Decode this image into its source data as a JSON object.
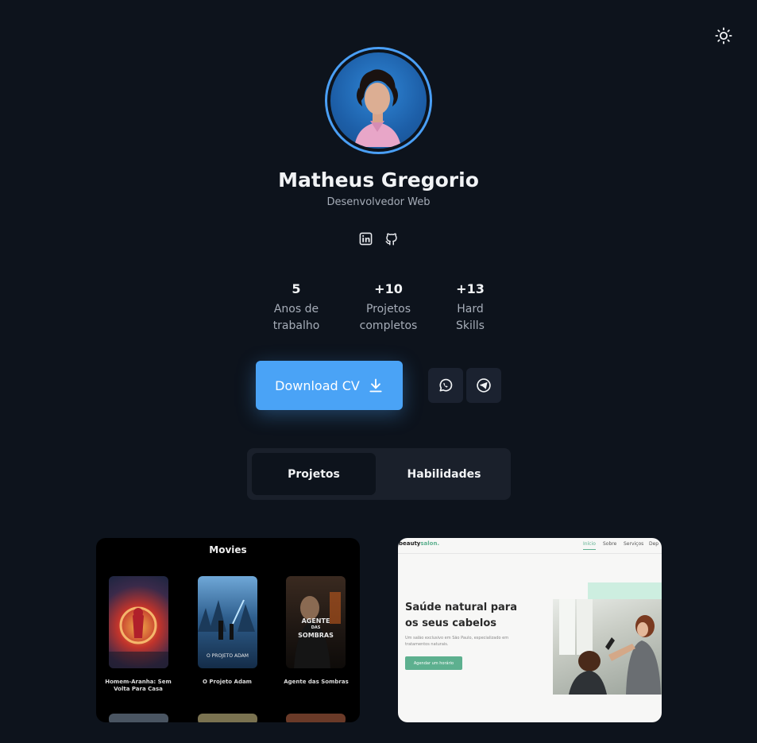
{
  "profile": {
    "name": "Matheus Gregorio",
    "role": "Desenvolvedor Web"
  },
  "socials": [
    {
      "icon": "linkedin-icon"
    },
    {
      "icon": "github-icon"
    }
  ],
  "stats": [
    {
      "value": "5",
      "label_line1": "Anos de",
      "label_line2": "trabalho"
    },
    {
      "value": "+10",
      "label_line1": "Projetos",
      "label_line2": "completos"
    },
    {
      "value": "+13",
      "label_line1": "Hard",
      "label_line2": "Skills"
    }
  ],
  "actions": {
    "download_label": "Download CV",
    "download_icon": "download-icon",
    "whatsapp_icon": "whatsapp-icon",
    "telegram_icon": "telegram-icon"
  },
  "tabs": [
    {
      "label": "Projetos",
      "active": true
    },
    {
      "label": "Habilidades",
      "active": false
    }
  ],
  "projects": {
    "movies": {
      "title": "Movies",
      "posters": [
        {
          "title_line1": "Homem-Aranha: Sem",
          "title_line2": "Volta Para Casa"
        },
        {
          "title_line1": "O Projeto Adam",
          "title_line2": "",
          "poster_text": "O PROJETO ADAM"
        },
        {
          "title_line1": "Agente das Sombras",
          "title_line2": "",
          "poster_text_1": "AGENTE",
          "poster_text_2": "DAS",
          "poster_text_3": "SOMBRAS"
        }
      ]
    },
    "beauty": {
      "logo_a": "beauty",
      "logo_b": "salon.",
      "nav": [
        "Início",
        "Sobre",
        "Serviços",
        "Dep"
      ],
      "headline_line1": "Saúde natural para",
      "headline_line2": "os seus cabelos",
      "paragraph": "Um salão exclusivo em São Paulo, especializado em tratamentos naturais.",
      "cta": "Agendar um horário"
    }
  },
  "colors": {
    "background": "#0d131c",
    "accent": "#4aa3f6",
    "beauty_accent": "#5db08f"
  },
  "theme_icon": "sun-icon"
}
